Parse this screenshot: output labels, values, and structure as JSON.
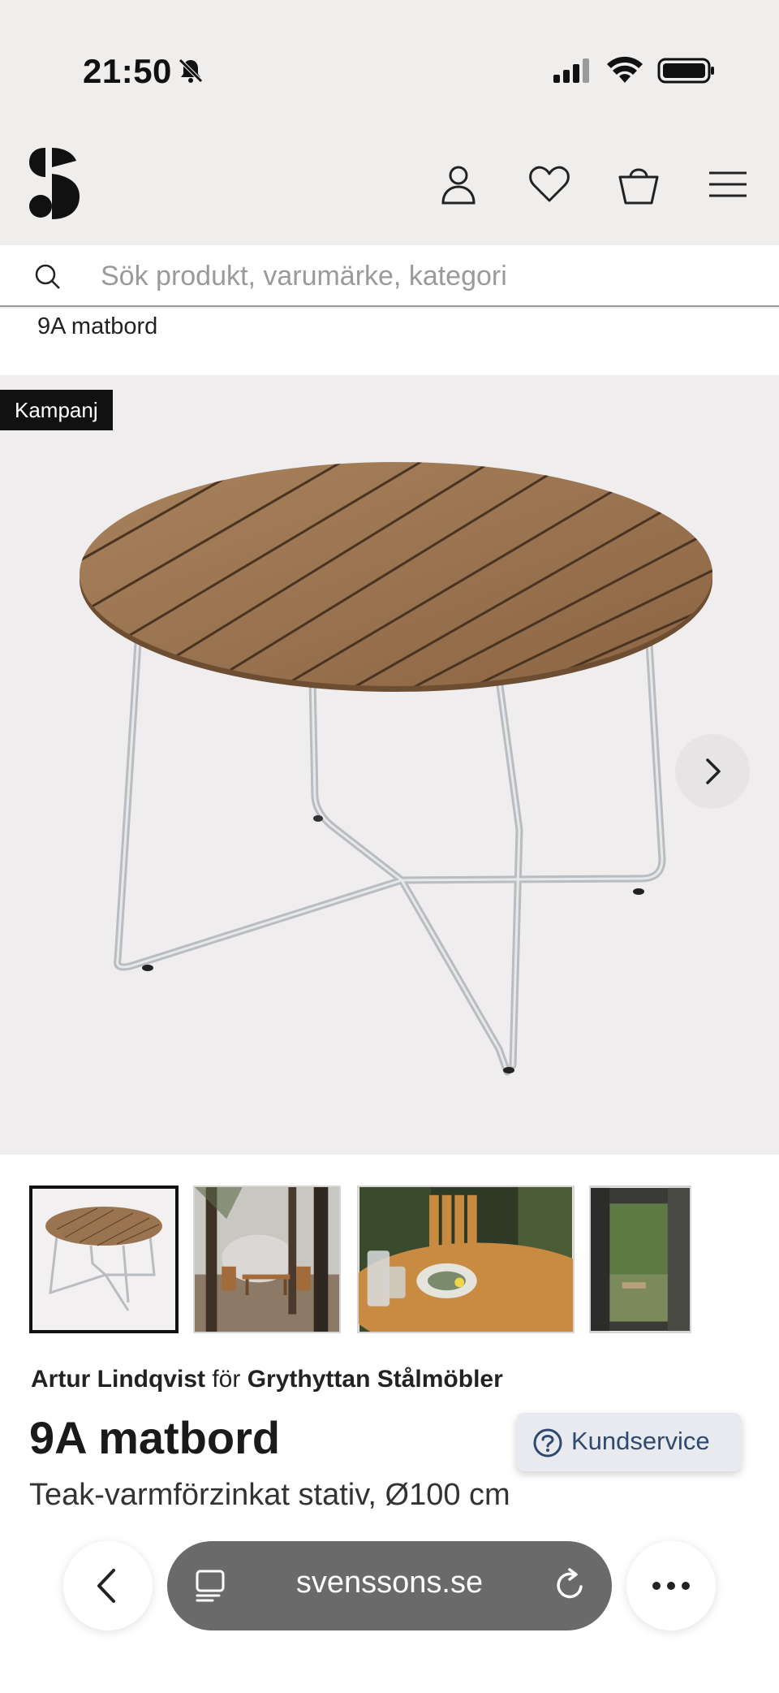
{
  "status_bar": {
    "time": "21:50"
  },
  "search": {
    "placeholder": "Sök produkt, varumärke, kategori",
    "value": ""
  },
  "breadcrumb": {
    "current": "9A matbord"
  },
  "gallery": {
    "badge": "Kampanj"
  },
  "product": {
    "designer": "Artur Lindqvist",
    "for_word": "för",
    "manufacturer": "Grythyttan Stålmöbler",
    "title": "9A matbord",
    "subtitle": "Teak-varmförzinkat stativ, Ø100 cm"
  },
  "support": {
    "label": "Kundservice"
  },
  "browser": {
    "url": "svenssons.se"
  },
  "colors": {
    "background": "#f0eeec",
    "accent": "#2e4a6e",
    "badge": "#111111"
  }
}
